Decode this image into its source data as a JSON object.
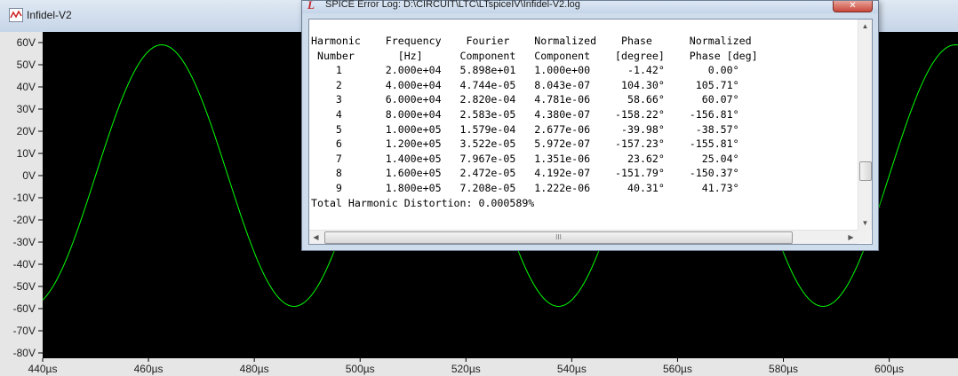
{
  "waveform_window": {
    "title": "Infidel-V2",
    "icon": "waveform-icon"
  },
  "chart_data": {
    "type": "line",
    "series": [
      {
        "color": "#00ff00",
        "amplitude": 58.98,
        "frequency_hz": 20000,
        "phase_deg": -1.42
      }
    ],
    "x": {
      "ticks": [
        "440µs",
        "460µs",
        "480µs",
        "500µs",
        "520µs",
        "540µs",
        "560µs",
        "580µs",
        "600µs"
      ],
      "range": [
        440,
        613
      ],
      "unit": "µs"
    },
    "y": {
      "ticks": [
        "60V",
        "50V",
        "40V",
        "30V",
        "20V",
        "10V",
        "0V",
        "-10V",
        "-20V",
        "-30V",
        "-40V",
        "-50V",
        "-60V",
        "-70V",
        "-80V"
      ],
      "range": [
        -80,
        60
      ]
    },
    "background": "#000000",
    "grid": false
  },
  "log_window": {
    "title": "SPICE Error Log: D:\\CIRCUIT\\LTC\\LTspiceIV\\Infidel-V2.log",
    "close_label": "✕",
    "lines": [
      "Harmonic    Frequency    Fourier    Normalized    Phase      Normalized",
      " Number       [Hz]      Component   Component    [degree]    Phase [deg]",
      "    1       2.000e+04   5.898e+01   1.000e+00      -1.42°       0.00°",
      "    2       4.000e+04   4.744e-05   8.043e-07     104.30°     105.71°",
      "    3       6.000e+04   2.820e-04   4.781e-06      58.66°      60.07°",
      "    4       8.000e+04   2.583e-05   4.380e-07    -158.22°    -156.81°",
      "    5       1.000e+05   1.579e-04   2.677e-06     -39.98°     -38.57°",
      "    6       1.200e+05   3.522e-05   5.972e-07    -157.23°    -155.81°",
      "    7       1.400e+05   7.967e-05   1.351e-06      23.62°      25.04°",
      "    8       1.600e+05   2.472e-05   4.192e-07    -151.79°    -150.37°",
      "    9       1.800e+05   7.208e-05   1.222e-06      40.31°      41.73°",
      "Total Harmonic Distortion: 0.000589%"
    ],
    "scroll": {
      "up": "▲",
      "down": "▼",
      "left": "◀",
      "right": "▶",
      "grip": "III"
    }
  }
}
